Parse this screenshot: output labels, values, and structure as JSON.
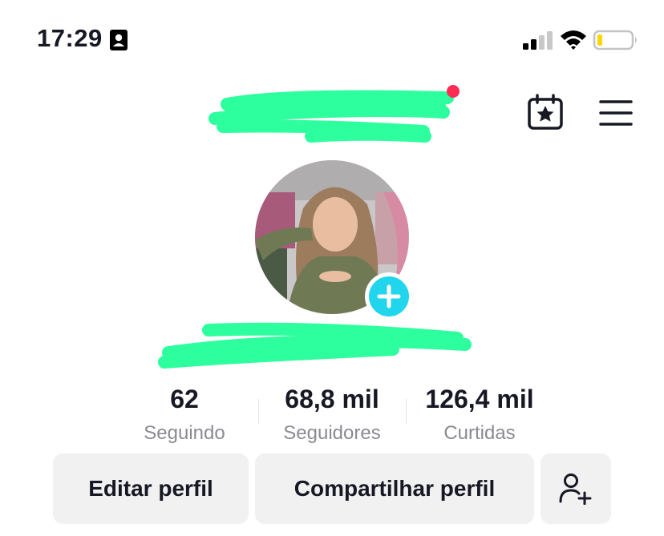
{
  "status_bar": {
    "time": "17:29"
  },
  "profile": {
    "stats": {
      "following": {
        "value": "62",
        "label": "Seguindo"
      },
      "followers": {
        "value": "68,8 mil",
        "label": "Seguidores"
      },
      "likes": {
        "value": "126,4 mil",
        "label": "Curtidas"
      }
    }
  },
  "actions": {
    "edit_label": "Editar perfil",
    "share_label": "Compartilhar perfil"
  },
  "colors": {
    "notification_dot": "#fe2c55",
    "add_story": "#20d5ec",
    "redaction": "#2eff9e",
    "button_bg": "#f1f1f2",
    "muted_text": "#8a8b91"
  },
  "icons": [
    "contact-card-icon",
    "signal-icon",
    "wifi-icon",
    "battery-icon",
    "calendar-star-icon",
    "menu-icon",
    "plus-icon",
    "add-user-icon"
  ]
}
